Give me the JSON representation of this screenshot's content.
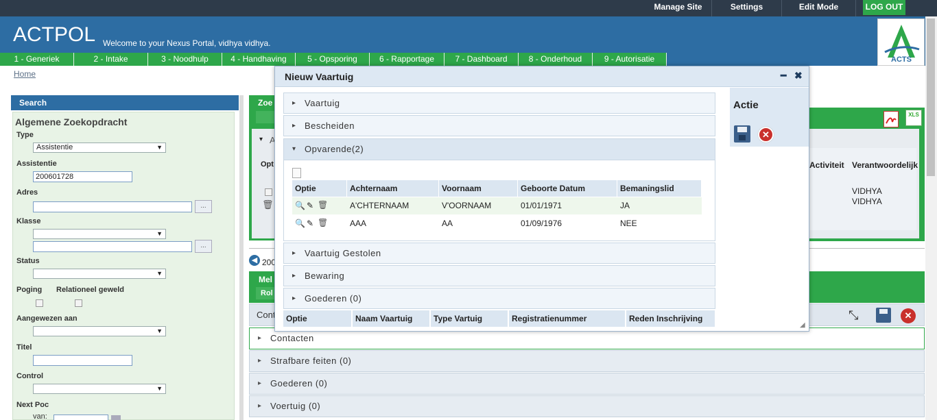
{
  "topbar": {
    "links": [
      "Manage Site",
      "Settings",
      "Edit Mode"
    ],
    "logout": "LOG OUT"
  },
  "header": {
    "title": "ACTPOL",
    "welcome": "Welcome to your Nexus Portal, vidhya vidhya.",
    "logo_text": "ACTS"
  },
  "nav": {
    "tabs": [
      "1 - Generiek",
      "2 - Intake",
      "3 - Noodhulp",
      "4 - Handhaving",
      "5 - Opsporing",
      "6 - Rapportage",
      "7 - Dashboard",
      "8 - Onderhoud",
      "9 - Autorisatie"
    ]
  },
  "breadcrumb": {
    "home": "Home"
  },
  "search": {
    "header": "Search",
    "title": "Algemene Zoekopdracht",
    "type_label": "Type",
    "type_value": "Assistentie",
    "assistentie_label": "Assistentie",
    "assistentie_value": "200601728",
    "adres_label": "Adres",
    "klasse_label": "Klasse",
    "status_label": "Status",
    "poging_label": "Poging",
    "relationeel_label": "Relationeel geweld",
    "aangewezen_label": "Aangewezen aan",
    "titel_label": "Titel",
    "control_label": "Control",
    "nextpoc_label": "Next Poc",
    "van_label": "van:",
    "dots": "..."
  },
  "main": {
    "tab_partial": "Zoe",
    "col_partial": "Opt",
    "a_partial": "A",
    "activiteit": "Activiteit",
    "verantwoordelijk": "Verantwoordelijk",
    "vidhya1": "VIDHYA",
    "vidhya2": "VIDHYA",
    "nav_num": "200",
    "mel_partial": "Mel",
    "rol_partial": "Rol",
    "cont_partial": "Cont",
    "sections": [
      "Contacten",
      "Strafbare feiten (0)",
      "Goederen (0)",
      "Voertuig (0)"
    ]
  },
  "modal": {
    "title": "Nieuw Vaartuig",
    "sections": {
      "vaartuig": "Vaartuig",
      "bescheiden": "Bescheiden",
      "opvarende": "Opvarende(2)",
      "gestolen": "Vaartuig Gestolen",
      "bewaring": "Bewaring",
      "goederen": "Goederen (0)"
    },
    "opvarende_table": {
      "headers": [
        "Optie",
        "Achternaam",
        "Voornaam",
        "Geboorte Datum",
        "Bemaningslid"
      ],
      "rows": [
        [
          "A'CHTERNAAM",
          "V'OORNAAM",
          "01/01/1971",
          "JA"
        ],
        [
          "AAA",
          "AA",
          "01/09/1976",
          "NEE"
        ]
      ]
    },
    "bottom_table": {
      "headers": [
        "Optie",
        "Naam Vaartuig",
        "Type Vartuig",
        "Registratienummer",
        "Reden Inschrijving"
      ]
    },
    "actie": "Actie"
  },
  "colors": {
    "topbar": "#2e3b4a",
    "header": "#2d6da3",
    "green": "#2ea74a",
    "modal_header": "#dde8f3"
  }
}
